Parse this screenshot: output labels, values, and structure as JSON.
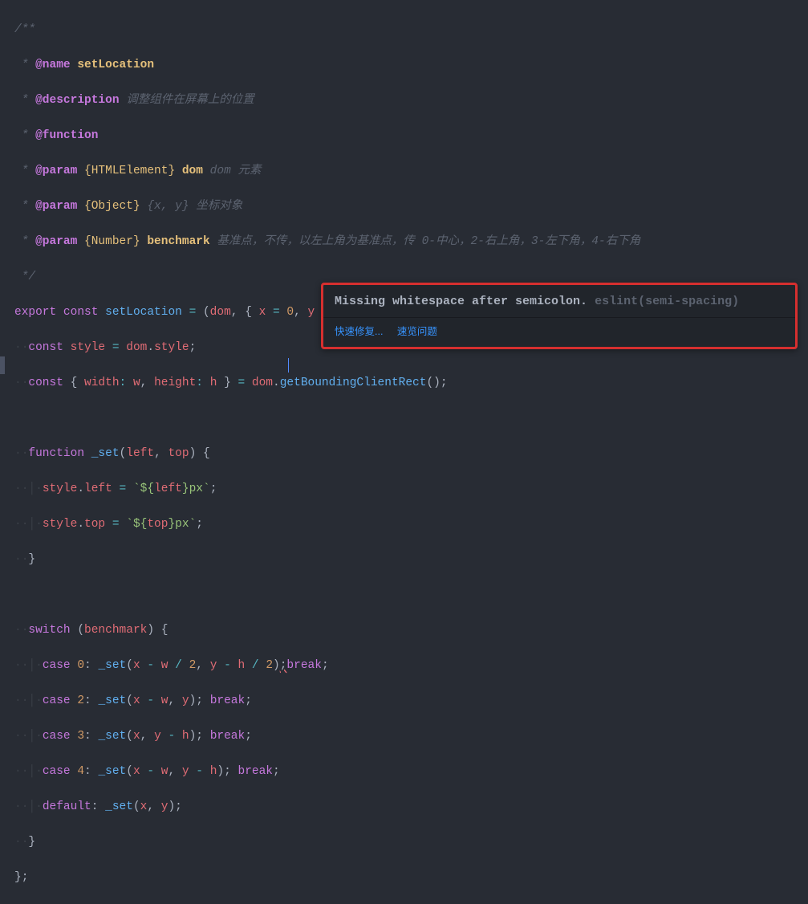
{
  "doc": {
    "open": "/**",
    "name_tag": "@name",
    "name_val": "setLocation",
    "desc_tag": "@description",
    "desc_text": "调整组件在屏幕上的位置",
    "func_tag": "@function",
    "param_tag": "@param",
    "type_html": "{HTMLElement}",
    "dom_name": "dom",
    "dom_desc": "dom 元素",
    "type_obj": "{Object}",
    "obj_name": "{x, y}",
    "obj_desc": "坐标对象",
    "type_num": "{Number}",
    "bench_name": "benchmark",
    "bench_desc": "基准点，不传，以左上角为基准点，传 0-中心，2-右上角，3-左下角，4-右下角",
    "close": " */"
  },
  "tok": {
    "export": "export",
    "const": "const",
    "setLocation": "setLocation",
    "eq": "=",
    "lp": "(",
    "rp": ")",
    "lb": "{",
    "rb": "}",
    "dom": "dom",
    "comma": ",",
    "x": "x",
    "y": "y",
    "zero": "0",
    "benchmark": "benchmark",
    "arrow": "⇒",
    "style": "style",
    "dot": ".",
    "width": "width",
    "w": "w",
    "height": "height",
    "h": "h",
    "colon": ":",
    "getRect": "getBoundingClientRect",
    "semi": ";",
    "function": "function",
    "_set": "_set",
    "left": "left",
    "top": "top",
    "tpl_open": "`${",
    "tpl_close": "}px`",
    "switch": "switch",
    "case": "case",
    "default": "default",
    "break": "break",
    "n2l": "2",
    "n3l": "3",
    "n4l": "4",
    "minus": "-",
    "div": "/",
    "two": "2"
  },
  "hover": {
    "msg": "Missing whitespace after semicolon. ",
    "rule": "eslint(semi-spacing)",
    "quickfix": "快速修复...",
    "peek": "速览问题"
  }
}
